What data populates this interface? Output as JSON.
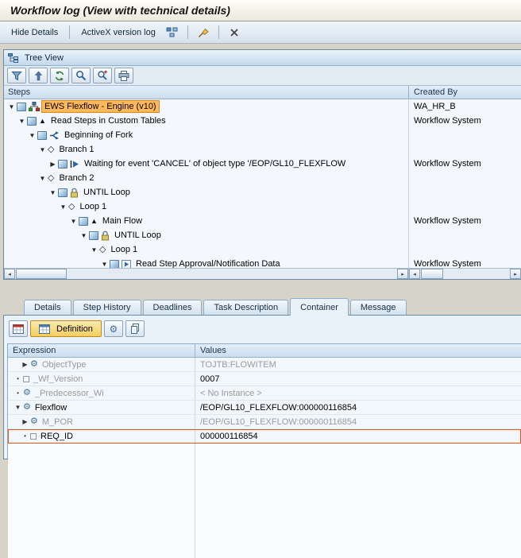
{
  "title": "Workflow log (View with technical details)",
  "colors": {
    "selection_highlight": "#FFB95C",
    "selection_border": "#E8551A",
    "muted_text": "#9A9A9A",
    "panel_header": "#C3D9EC",
    "definition_button": "#F3CD5F"
  },
  "app_toolbar": {
    "items": [
      {
        "type": "button",
        "name": "hide-details-button",
        "label": "Hide Details"
      },
      {
        "type": "separator"
      },
      {
        "type": "button",
        "name": "activex-version-log-button",
        "label": "ActiveX version log"
      },
      {
        "type": "icon-button",
        "name": "workflow-graphic-icon",
        "icon": "hierarchy"
      },
      {
        "type": "separator"
      },
      {
        "type": "icon-button",
        "name": "services-broom-icon",
        "icon": "broom"
      },
      {
        "type": "separator"
      },
      {
        "type": "icon-button",
        "name": "cancel-icon",
        "icon": "cancel"
      }
    ]
  },
  "tree": {
    "header": "Tree View",
    "toolbar_icons": [
      {
        "name": "filter-icon",
        "icon": "filter"
      },
      {
        "name": "sort-up-icon",
        "icon": "sortup"
      },
      {
        "name": "refresh-icon",
        "icon": "refresh"
      },
      {
        "name": "find-icon",
        "icon": "find"
      },
      {
        "name": "find-next-icon",
        "icon": "findnext"
      },
      {
        "name": "print-icon",
        "icon": "print"
      }
    ],
    "columns": {
      "steps": "Steps",
      "created_by": "Created By"
    },
    "rows": [
      {
        "indent": 0,
        "expander": "open",
        "icons": [
          {
            "name": "workflow-icon",
            "icon": "cube"
          },
          {
            "name": "engine-icon",
            "icon": "engine"
          }
        ],
        "label": "EWS Flexflow  - Engine (v10)",
        "created_by": "WA_HR_B",
        "selected": true
      },
      {
        "indent": 1,
        "expander": "open",
        "icons": [
          {
            "name": "workflow-icon",
            "icon": "cube"
          },
          {
            "name": "step-icon",
            "icon": "tri"
          }
        ],
        "label": "Read Steps in Custom Tables",
        "created_by": "Workflow System"
      },
      {
        "indent": 2,
        "expander": "open",
        "icons": [
          {
            "name": "workflow-icon",
            "icon": "cube"
          },
          {
            "name": "fork-icon",
            "icon": "fork"
          }
        ],
        "label": "Beginning of Fork",
        "created_by": ""
      },
      {
        "indent": 3,
        "expander": "open",
        "icons": [
          {
            "name": "branch-icon",
            "icon": "branch"
          }
        ],
        "label": "Branch 1",
        "created_by": ""
      },
      {
        "indent": 4,
        "expander": "closed",
        "icons": [
          {
            "name": "workflow-icon",
            "icon": "cube"
          },
          {
            "name": "wait-event-icon",
            "icon": "event"
          }
        ],
        "label": "Waiting for event 'CANCEL' of object type '/EOP/GL10_FLEXFLOW",
        "created_by": "Workflow System"
      },
      {
        "indent": 3,
        "expander": "open",
        "icons": [
          {
            "name": "branch-icon",
            "icon": "branch"
          }
        ],
        "label": "Branch 2",
        "created_by": ""
      },
      {
        "indent": 4,
        "expander": "open",
        "icons": [
          {
            "name": "workflow-icon",
            "icon": "cube"
          },
          {
            "name": "until-loop-icon",
            "icon": "lock"
          }
        ],
        "label": "UNTIL Loop",
        "created_by": ""
      },
      {
        "indent": 5,
        "expander": "open",
        "icons": [
          {
            "name": "loop-branch-icon",
            "icon": "branch"
          }
        ],
        "label": "Loop 1",
        "created_by": ""
      },
      {
        "indent": 6,
        "expander": "open",
        "icons": [
          {
            "name": "workflow-icon",
            "icon": "cube"
          },
          {
            "name": "step-icon",
            "icon": "tri"
          }
        ],
        "label": "Main Flow",
        "created_by": "Workflow System"
      },
      {
        "indent": 7,
        "expander": "open",
        "icons": [
          {
            "name": "workflow-icon",
            "icon": "cube"
          },
          {
            "name": "until-loop-icon",
            "icon": "lock"
          }
        ],
        "label": "UNTIL Loop",
        "created_by": ""
      },
      {
        "indent": 8,
        "expander": "open",
        "icons": [
          {
            "name": "loop-branch-icon",
            "icon": "branch"
          }
        ],
        "label": "Loop 1",
        "created_by": ""
      },
      {
        "indent": 9,
        "expander": "open",
        "icons": [
          {
            "name": "workflow-icon",
            "icon": "cube"
          },
          {
            "name": "read-step-icon",
            "icon": "read"
          }
        ],
        "label": "Read Step Approval/Notification Data",
        "created_by": "Workflow System"
      }
    ]
  },
  "tabs": {
    "items": [
      "Details",
      "Step History",
      "Deadlines",
      "Task Description",
      "Container",
      "Message"
    ],
    "active": "Container"
  },
  "container": {
    "toolbar": {
      "pre_icons": [
        {
          "name": "table-settings-icon",
          "icon": "gridred"
        }
      ],
      "definition_label": "Definition",
      "post_icons": [
        {
          "name": "display-change-icon",
          "icon": "gearpencil"
        },
        {
          "name": "copy-icon",
          "icon": "copy"
        }
      ]
    },
    "columns": {
      "expression": "Expression",
      "values": "Values"
    },
    "rows": [
      {
        "indent": 1,
        "marker": "closed",
        "icon": "gear",
        "icon_name": "object-type-icon",
        "expression": "ObjectType",
        "value": "TOJTB:FLOWITEM",
        "expr_muted": true,
        "val_muted": true
      },
      {
        "indent": 0,
        "marker": "dot",
        "icon": "square",
        "icon_name": "value-field-icon",
        "expression": "_Wf_Version",
        "value": "0007",
        "expr_muted": true,
        "val_muted": false
      },
      {
        "indent": 0,
        "marker": "dot",
        "icon": "gear",
        "icon_name": "object-type-icon",
        "expression": "_Predecessor_Wi",
        "value": "< No Instance >",
        "expr_muted": true,
        "val_muted": true
      },
      {
        "indent": 0,
        "marker": "open",
        "icon": "gear",
        "icon_name": "object-type-icon",
        "expression": "Flexflow",
        "value": "/EOP/GL10_FLEXFLOW:000000116854",
        "expr_muted": false,
        "val_muted": false
      },
      {
        "indent": 1,
        "marker": "closed",
        "icon": "gear",
        "icon_name": "object-type-icon",
        "expression": "M_POR",
        "value": "/EOP/GL10_FLEXFLOW:000000116854",
        "expr_muted": true,
        "val_muted": true
      },
      {
        "indent": 1,
        "marker": "dot",
        "icon": "square",
        "icon_name": "value-field-icon",
        "expression": "REQ_ID",
        "value": "000000116854",
        "expr_muted": false,
        "val_muted": false,
        "selected": true
      }
    ]
  }
}
